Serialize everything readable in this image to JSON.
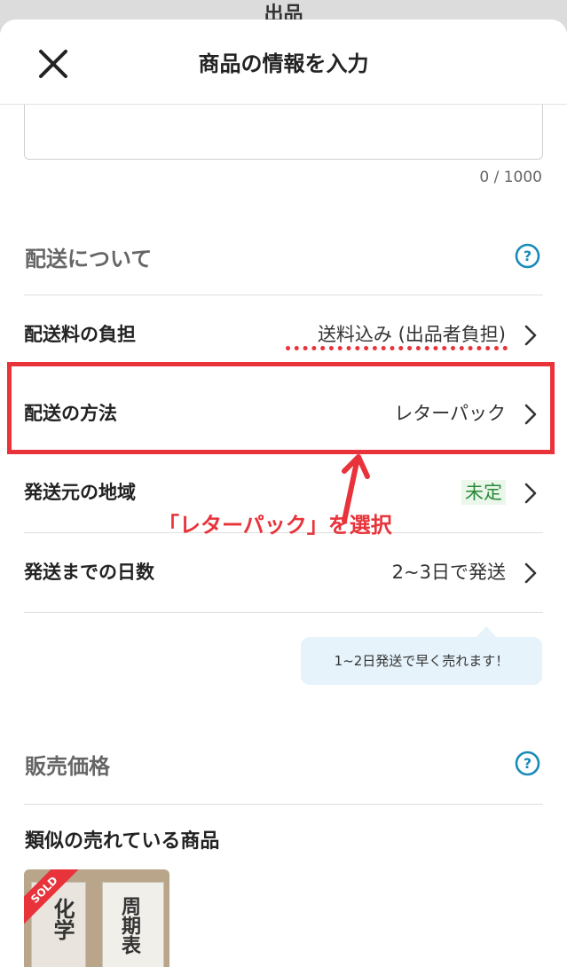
{
  "background_peek_text": "出品",
  "header": {
    "title": "商品の情報を入力",
    "close_icon": "close-icon"
  },
  "description": {
    "counter": "0 / 1000"
  },
  "shipping_section": {
    "title": "配送について",
    "help_icon": "question-circle-icon",
    "rows": [
      {
        "label": "配送料の負担",
        "value": "送料込み (出品者負担)"
      },
      {
        "label": "配送の方法",
        "value": "レターパック"
      },
      {
        "label": "発送元の地域",
        "value": "未定"
      },
      {
        "label": "発送までの日数",
        "value": "2~3日で発送"
      }
    ],
    "tooltip": "1~2日発送で早く売れます！"
  },
  "annotation": {
    "text": "「レターパック」を選択",
    "color": "#e8333a"
  },
  "price_section": {
    "title": "販売価格",
    "help_icon": "question-circle-icon"
  },
  "similar_section": {
    "title": "類似の売れている商品",
    "items": [
      {
        "badge": "SOLD",
        "book1_title": "化学",
        "book2_title": "周期表"
      }
    ]
  },
  "colors": {
    "accent_red": "#e8333a",
    "help_blue": "#1a8bb8",
    "tooltip_bg": "#e6f3fb",
    "tag_green": "#2a8a3a"
  }
}
